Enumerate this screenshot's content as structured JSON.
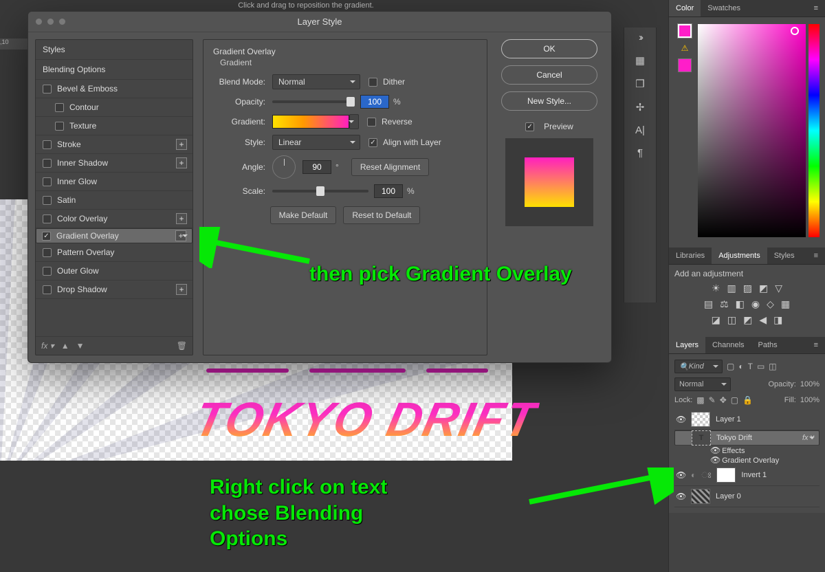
{
  "top_hint": "Click and drag to reposition the gradient.",
  "dialog": {
    "title": "Layer Style",
    "left": {
      "header": "Styles",
      "blending": "Blending Options",
      "items": [
        {
          "label": "Bevel & Emboss",
          "checked": false,
          "plus": false
        },
        {
          "label": "Contour",
          "checked": false,
          "plus": false,
          "indent": true
        },
        {
          "label": "Texture",
          "checked": false,
          "plus": false,
          "indent": true
        },
        {
          "label": "Stroke",
          "checked": false,
          "plus": true
        },
        {
          "label": "Inner Shadow",
          "checked": false,
          "plus": true
        },
        {
          "label": "Inner Glow",
          "checked": false,
          "plus": false
        },
        {
          "label": "Satin",
          "checked": false,
          "plus": false
        },
        {
          "label": "Color Overlay",
          "checked": false,
          "plus": true
        },
        {
          "label": "Gradient Overlay",
          "checked": true,
          "plus": true,
          "selected": true
        },
        {
          "label": "Pattern Overlay",
          "checked": false,
          "plus": false
        },
        {
          "label": "Outer Glow",
          "checked": false,
          "plus": false
        },
        {
          "label": "Drop Shadow",
          "checked": false,
          "plus": true
        }
      ]
    },
    "section_title": "Gradient Overlay",
    "section_sub": "Gradient",
    "blend_mode_label": "Blend Mode:",
    "blend_mode_value": "Normal",
    "dither": "Dither",
    "opacity_label": "Opacity:",
    "opacity_value": "100",
    "percent": "%",
    "gradient_label": "Gradient:",
    "reverse": "Reverse",
    "style_label": "Style:",
    "style_value": "Linear",
    "align": "Align with Layer",
    "angle_label": "Angle:",
    "angle_value": "90",
    "degree": "°",
    "reset_align": "Reset Alignment",
    "scale_label": "Scale:",
    "scale_value": "100",
    "make_default": "Make Default",
    "reset_default": "Reset to Default",
    "actions": {
      "ok": "OK",
      "cancel": "Cancel",
      "new_style": "New Style...",
      "preview": "Preview"
    }
  },
  "canvas_text": "TOKYO DRIFT",
  "annotations": {
    "a1": "then pick Gradient Overlay",
    "a2_l1": "Right click on text",
    "a2_l2": "chose Blending",
    "a2_l3": "Options"
  },
  "right": {
    "color_tab": "Color",
    "swatches_tab": "Swatches",
    "lib_tab": "Libraries",
    "adj_tab": "Adjustments",
    "styles_tab": "Styles",
    "add_adj": "Add an adjustment",
    "layers_tab": "Layers",
    "channels_tab": "Channels",
    "paths_tab": "Paths",
    "kind": "Kind",
    "blend": "Normal",
    "opacity_label": "Opacity:",
    "opacity_val": "100%",
    "lock": "Lock:",
    "fill_label": "Fill:",
    "fill_val": "100%",
    "layers": [
      {
        "name": "Layer 1",
        "thumb": "checker"
      },
      {
        "name": "Tokyo Drift",
        "thumb": "T",
        "selected": true,
        "fx": true
      },
      {
        "name": "Effects",
        "sub": true
      },
      {
        "name": "Gradient Overlay",
        "sub": true
      },
      {
        "name": "Invert 1",
        "thumb": "white",
        "extra": true
      },
      {
        "name": "Layer 0",
        "thumb": "pattern"
      }
    ]
  },
  "ruler": ",10"
}
